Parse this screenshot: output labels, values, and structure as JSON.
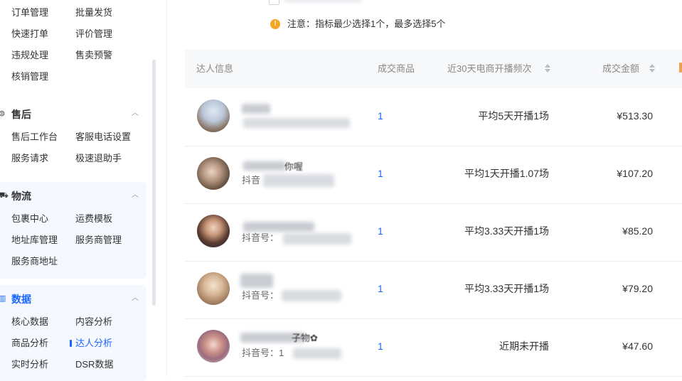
{
  "sidebar": {
    "orders": {
      "items": [
        "订单管理",
        "批量发货",
        "快速打单",
        "评价管理",
        "违规处理",
        "售卖预警",
        "核销管理"
      ]
    },
    "after_sales": {
      "title": "售后",
      "items": [
        "售后工作台",
        "客服电话设置",
        "服务请求",
        "极速退助手"
      ]
    },
    "logistics": {
      "title": "物流",
      "items": [
        "包裹中心",
        "运费模板",
        "地址库管理",
        "服务商管理",
        "服务商地址"
      ]
    },
    "data": {
      "title": "数据",
      "items": [
        "核心数据",
        "内容分析",
        "商品分析",
        "达人分析",
        "实时分析",
        "DSR数据"
      ],
      "active": "达人分析"
    },
    "accent_color": "#1966ff"
  },
  "notice": {
    "text": "注意：指标最少选择1个，最多选择5个",
    "icon": "exclamation-icon",
    "icon_color": "#f5a623"
  },
  "table": {
    "headers": {
      "talent": "达人信息",
      "goods": "成交商品",
      "frequency": "近30天电商开播频次",
      "amount": "成交金额"
    },
    "rows": [
      {
        "id_label": "",
        "name_tail": "",
        "goods": "1",
        "frequency": "平均5天开播1场",
        "amount": "¥513.30"
      },
      {
        "id_label": "抖音",
        "name_tail": "你喔",
        "goods": "1",
        "frequency": "平均1天开播1.07场",
        "amount": "¥107.20"
      },
      {
        "id_label": "抖音号：",
        "name_tail": "",
        "goods": "1",
        "frequency": "平均3.33天开播1场",
        "amount": "¥85.20"
      },
      {
        "id_label": "抖音号：",
        "name_tail": "",
        "goods": "1",
        "frequency": "平均3.33天开播1场",
        "amount": "¥79.20"
      },
      {
        "id_label": "抖音号：1",
        "name_tail": "子物✿",
        "goods": "1",
        "frequency": "近期未开播",
        "amount": "¥47.60"
      }
    ]
  }
}
